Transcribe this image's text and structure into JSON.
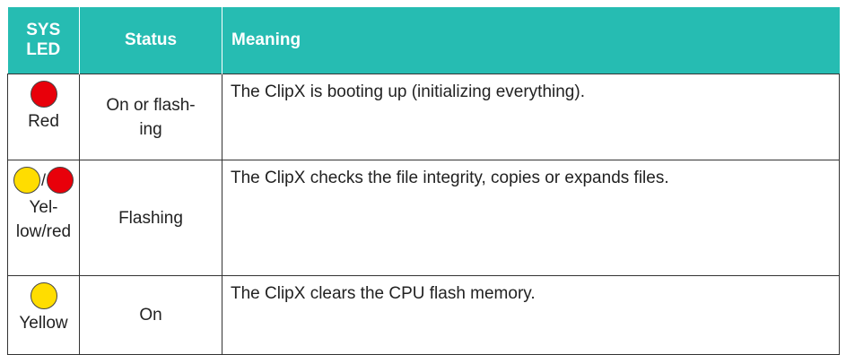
{
  "headers": {
    "sys_led_line1": "SYS",
    "sys_led_line2": "LED",
    "status": "Status",
    "meaning": "Meaning"
  },
  "rows": [
    {
      "led_colors": [
        "#e8000a"
      ],
      "led_label": "Red",
      "status_line1": "On or flash-",
      "status_line2": "ing",
      "meaning": "The ClipX is booting up (initializing everything)."
    },
    {
      "led_colors": [
        "#ffdd00",
        "#e8000a"
      ],
      "led_separator": "/",
      "led_label_line1": "Yel-",
      "led_label_line2": "low/red",
      "status": "Flashing",
      "meaning": "The ClipX checks the file integrity, copies or expands files."
    },
    {
      "led_colors": [
        "#ffdd00"
      ],
      "led_label": "Yellow",
      "status": "On",
      "meaning": "The ClipX clears the CPU flash memory."
    }
  ],
  "colors": {
    "header_bg": "#26bcb2",
    "header_text": "#ffffff",
    "red_led": "#e8000a",
    "yellow_led": "#ffdd00"
  }
}
